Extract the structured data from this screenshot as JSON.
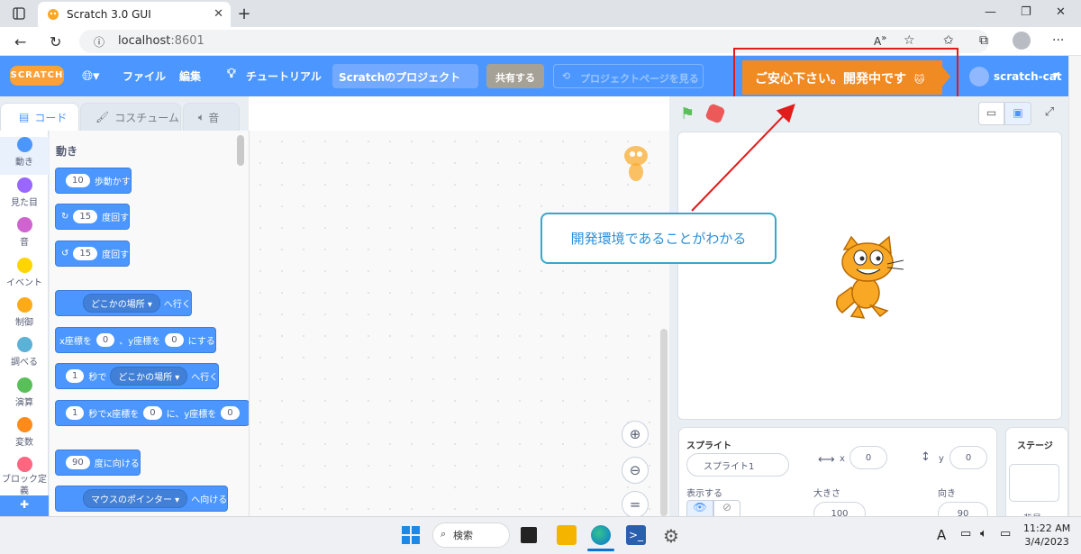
{
  "browser": {
    "tab_title": "Scratch 3.0 GUI",
    "url_host": "localhost",
    "url_port": ":8601",
    "reader_icon_text": "Aᴬ"
  },
  "menubar": {
    "logo": "SCRATCH",
    "file": "ファイル",
    "edit": "編集",
    "tutorials": "チュートリアル",
    "project_title": "Scratchのプロジェクト",
    "share": "共有する",
    "see_project": "プロジェクトページを見る",
    "banner": "ご安心下さい。開発中です",
    "username": "scratch-cat"
  },
  "tabs": {
    "code": "コード",
    "costumes": "コスチューム",
    "sounds": "音"
  },
  "categories": [
    {
      "label": "動き",
      "color": "#4c97ff"
    },
    {
      "label": "見た目",
      "color": "#9966ff"
    },
    {
      "label": "音",
      "color": "#cf63cf"
    },
    {
      "label": "イベント",
      "color": "#ffd500"
    },
    {
      "label": "制御",
      "color": "#ffab19"
    },
    {
      "label": "調べる",
      "color": "#5cb1d6"
    },
    {
      "label": "演算",
      "color": "#59c059"
    },
    {
      "label": "変数",
      "color": "#ff8c1a"
    },
    {
      "label": "ブロック定義",
      "color": "#ff6680"
    }
  ],
  "palette": {
    "heading": "動き",
    "move_steps": "10",
    "move_label": "歩動かす",
    "turn_right_deg": "15",
    "turn_left_deg": "15",
    "turn_label": "度回す",
    "goto_target": "どこかの場所",
    "goto_label": "へ行く",
    "gotoxy_x_label": "x座標を",
    "gotoxy_x": "0",
    "gotoxy_y_label": "、y座標を",
    "gotoxy_y": "0",
    "gotoxy_end": "にする",
    "glide_secs": "1",
    "glide_label": "秒で",
    "glide_target": "どこかの場所",
    "glide_end": "へ行く",
    "glidexy_secs": "1",
    "glidexy_label": "秒でx座標を",
    "glidexy_x": "0",
    "glidexy_mid": "に、y座標を",
    "glidexy_y": "0",
    "point_dir": "90",
    "point_label": "度に向ける",
    "pointto_target": "マウスのポインター",
    "pointto_label": "へ向ける"
  },
  "callout": "開発環境であることがわかる",
  "sprite_info": {
    "sprite_label": "スプライト",
    "sprite_name": "スプライト1",
    "x_label": "x",
    "x_value": "0",
    "y_label": "y",
    "y_value": "0",
    "show_label": "表示する",
    "size_label": "大きさ",
    "size_value": "100",
    "direction_label": "向き",
    "direction_value": "90",
    "stage_label": "ステージ",
    "backdrops_label": "背景"
  },
  "taskbar": {
    "search": "検索",
    "time": "11:22 AM",
    "date": "3/4/2023",
    "ime": "A"
  }
}
